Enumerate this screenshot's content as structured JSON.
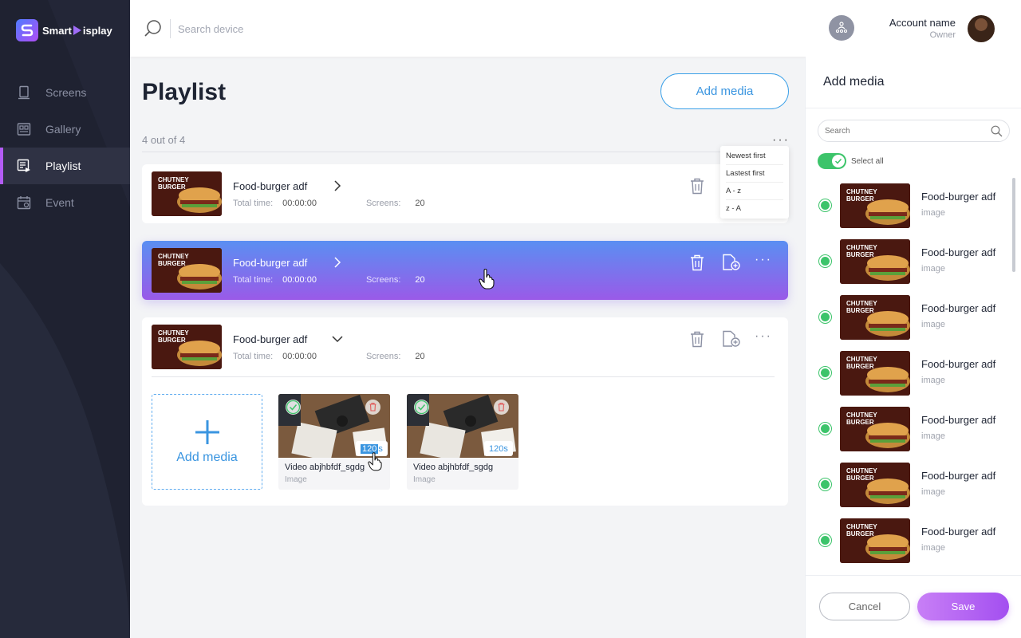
{
  "app": {
    "name_part1": "Smart",
    "name_part2": "isplay"
  },
  "colors": {
    "accent_blue": "#3a95e0",
    "accent_purple": "#a34ff0",
    "success_green": "#3cc46a",
    "sidebar_bg": "#1f2231"
  },
  "sidebar": {
    "items": [
      {
        "label": "Screens",
        "icon": "monitor-icon"
      },
      {
        "label": "Gallery",
        "icon": "gallery-icon"
      },
      {
        "label": "Playlist",
        "icon": "playlist-icon",
        "active": true
      },
      {
        "label": "Event",
        "icon": "calendar-icon"
      }
    ]
  },
  "topbar": {
    "search_placeholder": "Search device",
    "account_name": "Account name",
    "account_role": "Owner"
  },
  "main": {
    "title": "Playlist",
    "add_media_label": "Add media",
    "count_text": "4 out of 4",
    "more_label": "···",
    "sort_options": [
      "Newest first",
      "Lastest first",
      "A - z",
      "z - A"
    ],
    "playlists": [
      {
        "name": "Food-burger adf",
        "total_time_label": "Total time:",
        "total_time": "00:00:00",
        "screens_label": "Screens:",
        "screens": "20",
        "chevron": ">"
      },
      {
        "name": "Food-burger adf",
        "total_time_label": "Total time:",
        "total_time": "00:00:00",
        "screens_label": "Screens:",
        "screens": "20",
        "chevron": ">"
      },
      {
        "name": "Food-burger adf",
        "total_time_label": "Total time:",
        "total_time": "00:00:00",
        "screens_label": "Screens:",
        "screens": "20",
        "chevron": "v"
      }
    ],
    "thumb_text": {
      "line1": "CHUTNEY",
      "line2": "BURGER"
    },
    "expanded": {
      "add_tile_label": "Add media",
      "media": [
        {
          "title": "Video abjhbfdf_sgdg",
          "subtitle": "Image",
          "duration_value": "120",
          "duration_unit": " s"
        },
        {
          "title": "Video abjhbfdf_sgdg",
          "subtitle": "Image",
          "duration_value": "120",
          "duration_unit": " s"
        }
      ]
    }
  },
  "panel": {
    "title": "Add media",
    "search_placeholder": "Search",
    "select_all_label": "Select all",
    "items": [
      {
        "name": "Food-burger adf",
        "type": "image"
      },
      {
        "name": "Food-burger adf",
        "type": "image"
      },
      {
        "name": "Food-burger adf",
        "type": "image"
      },
      {
        "name": "Food-burger adf",
        "type": "image"
      },
      {
        "name": "Food-burger adf",
        "type": "image"
      },
      {
        "name": "Food-burger adf",
        "type": "image"
      },
      {
        "name": "Food-burger adf",
        "type": "image"
      }
    ],
    "cancel_label": "Cancel",
    "save_label": "Save"
  }
}
